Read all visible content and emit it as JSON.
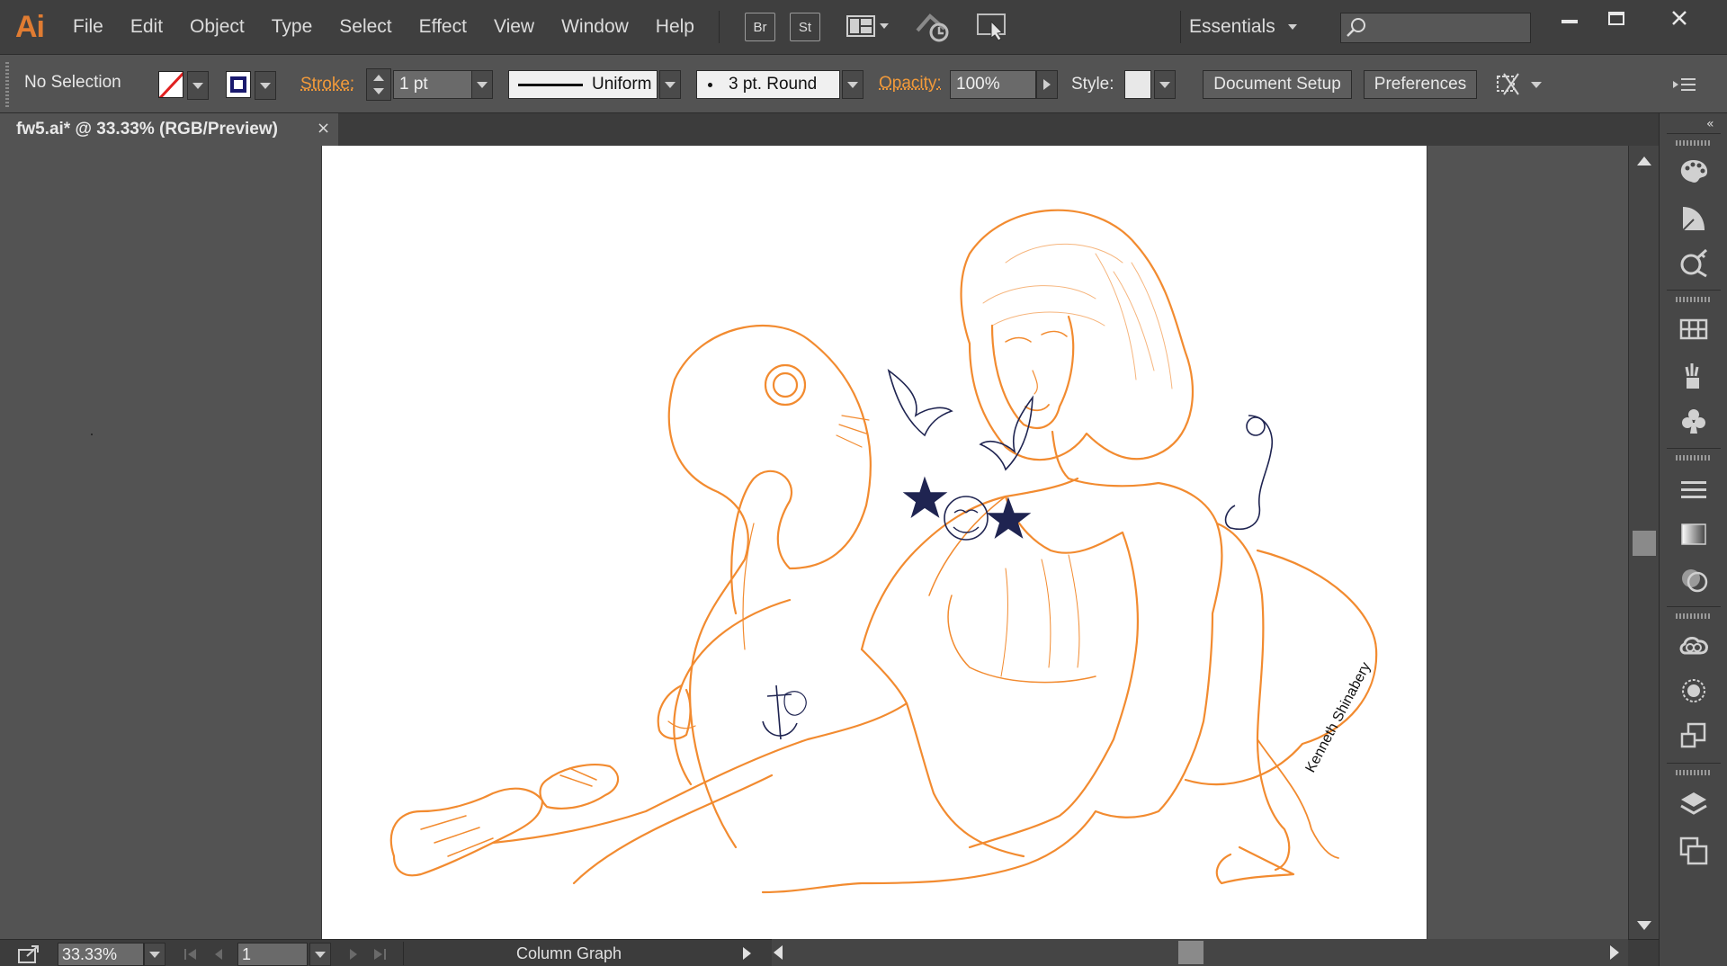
{
  "app": {
    "logo": "Ai",
    "accent": "#e07c32"
  },
  "menu": {
    "items": [
      "File",
      "Edit",
      "Object",
      "Type",
      "Select",
      "Effect",
      "View",
      "Window",
      "Help"
    ],
    "bridge_label": "Br",
    "stock_label": "St",
    "workspace": "Essentials"
  },
  "control_bar": {
    "selection_status": "No Selection",
    "stroke_label": "Stroke:",
    "stroke_weight": "1 pt",
    "variable_width_profile": "Uniform",
    "brush_definition": "3 pt. Round",
    "opacity_label": "Opacity:",
    "opacity_value": "100%",
    "style_label": "Style:",
    "document_setup_label": "Document Setup",
    "preferences_label": "Preferences"
  },
  "document": {
    "tab_title": "fw5.ai* @ 33.33% (RGB/Preview)",
    "close_glyph": "×",
    "artwork_color": "#f28b30",
    "tattoo_color": "#1f2451",
    "signature": "Kenneth Shinabery"
  },
  "status_bar": {
    "zoom": "33.33%",
    "artboard_number": "1",
    "status_text": "Column Graph"
  },
  "dock": {
    "icons": [
      "color-palette-icon",
      "color-guide-icon",
      "image-trace-icon",
      "swatches-icon",
      "brushes-icon",
      "symbols-icon",
      "stroke-icon",
      "gradient-icon",
      "transparency-icon",
      "cc-libraries-icon",
      "appearance-icon",
      "graphic-styles-icon",
      "layers-icon",
      "artboards-icon"
    ]
  }
}
